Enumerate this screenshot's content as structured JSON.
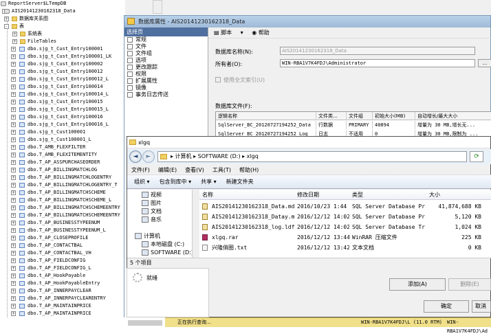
{
  "object_explorer": {
    "top_rows": [
      "ReportServer$LTempDB",
      "AIS20141230162318_Data",
      "数据库关系图",
      "表",
      "系统表",
      "FileTables"
    ],
    "tables": [
      "dbo.sjg_t_Cust_Entry100001",
      "dbo.sjg_t_Cust_Entry100001_LK",
      "dbo.sjg_t_Cust_Entry100002",
      "dbo.sjg_t_Cust_Entry100012",
      "dbo.sjg_t_Cust_Entry100012_L",
      "dbo.sjg_t_Cust_Entry100014",
      "dbo.sjg_t_Cust_Entry100014_L",
      "dbo.sjg_t_Cust_Entry100015",
      "dbo.sjg_t_Cust_Entry100015_L",
      "dbo.sjg_t_Cust_Entry100016",
      "dbo.sjg_t_Cust_Entry100016_L",
      "dbo.sjg_t_Cust100001",
      "dbo.sjg_t_Cust100001_L",
      "dbo.T_AMB_FLEXFILTER",
      "dbo.T_AMB_FLEXITEMENTITY",
      "dbo.T_AP_ASSPURCHASEORDER",
      "dbo.T_AP_BILLINGMATCHLOG",
      "dbo.T_AP_BILLINGMATCHLOGENTRY",
      "dbo.T_AP_BILLINGMATCHLOGENTRY_T",
      "dbo.T_AP_BILLINGMATCHSCHEME",
      "dbo.T_AP_BILLINGMATCHSCHEME_L",
      "dbo.T_AP_BILLINGMATCHSCHEMEENTRY",
      "dbo.T_AP_BILLINGMATCHSCHEMEENTRY",
      "dbo.T_AP_BUSINESSTYPEENUM",
      "dbo.T_AP_BUSINESSTYPEENUM_L",
      "dbo.T_AP_CLOSEPROFILE",
      "dbo.T_AP_CONTACTBAL",
      "dbo.T_AP_CONTACTBAL_VH",
      "dbo.T_AP_FIELDCONFIG",
      "dbo.T_AP_FIELDCONFIG_L",
      "dbo.t_AP_HookPayable",
      "dbo.t_AP_HookPayableEntry",
      "dbo.T_AP_INNERPAYCLEAR",
      "dbo.T_AP_INNERPAYCLEARENTRY",
      "dbo.T_AP_MAINTAINPRICE",
      "dbo.T_AP_MAINTAINPRICE"
    ]
  },
  "db_props": {
    "title": "数据库属性 - AIS20141230162318_Data",
    "select_page": "选择页",
    "pages": [
      "常规",
      "文件",
      "文件组",
      "选项",
      "更改跟踪",
      "权限",
      "扩展属性",
      "镜像",
      "事务日志传送"
    ],
    "toolbar": {
      "script": "脚本",
      "help": "帮助"
    },
    "db_name_label": "数据库名称(N):",
    "db_name_value": "AIS20141230162318_Data",
    "owner_label": "所有者(O):",
    "owner_value": "WIN-RBA1V7K4FDJ\\Administrator",
    "fulltext_label": "使用全文索引(U)",
    "db_files_label": "数据库文件(F):",
    "grid_headers": [
      "逻辑名称",
      "文件类...",
      "文件组",
      "初始大小(MB)",
      "自动增长/最大大小"
    ],
    "grid_rows": [
      [
        "SqlServer_BC_20120727194252_Data",
        "行数据",
        "PRIMARY",
        "40894",
        "增量为 30 MB,增长无..."
      ],
      [
        "SqlServer_BC_20120727194252_Log",
        "日志",
        "不适用",
        "0",
        "增量为 30 MB,限制为 ..."
      ]
    ],
    "ready": "就绪",
    "add_label": "添加(A)",
    "delete_label": "删除(E)",
    "ok_label": "确定",
    "cancel_label": "取消"
  },
  "explorer": {
    "title": "xlgq",
    "address": "▸ 计算机 ▸ SOFTWARE (D:) ▸ xlgq",
    "menu": [
      "文件(F)",
      "编辑(E)",
      "查看(V)",
      "工具(T)",
      "帮助(H)"
    ],
    "commands": [
      "组织 ▾",
      "包含到库中 ▾",
      "共享 ▾",
      "新建文件夹"
    ],
    "nav_items": [
      "视频",
      "图片",
      "文档",
      "音乐",
      "计算机",
      "本地磁盘 (C:)",
      "SOFTWARE (D:)"
    ],
    "columns": [
      "名称",
      "修改日期",
      "类型",
      "大小"
    ],
    "files": [
      {
        "name": "AIS20141230162318_Data.mdf",
        "date": "2016/10/23 1:44",
        "type": "SQL Server Database Pr...",
        "size": "41,874,688 KB",
        "icon": "mdf"
      },
      {
        "name": "AIS20141230162318_Datay.mdf",
        "date": "2016/12/12 14:02",
        "type": "SQL Server Database Pr...",
        "size": "5,120 KB",
        "icon": "mdf"
      },
      {
        "name": "AIS20141230162318_log.ldf",
        "date": "2016/12/12 14:02",
        "type": "SQL Server Database Tr...",
        "size": "1,024 KB",
        "icon": "mdf"
      },
      {
        "name": "xlgq.rar",
        "date": "2016/12/12 13:44",
        "type": "WinRAR 压缩文件",
        "size": "225 KB",
        "icon": "rar"
      },
      {
        "name": "兴隆俏圈.txt",
        "date": "2016/12/12 13:42",
        "type": "文本文档",
        "size": "0 KB",
        "icon": "txt"
      }
    ],
    "status": "5 个项目"
  },
  "bottom_status": {
    "query": "正在执行查询...",
    "server": "WIN-RBA1V7K4FDJ\\L (11.0 RTM)",
    "user": "WIN-RBA1V7K4FDJ\\Ad"
  }
}
